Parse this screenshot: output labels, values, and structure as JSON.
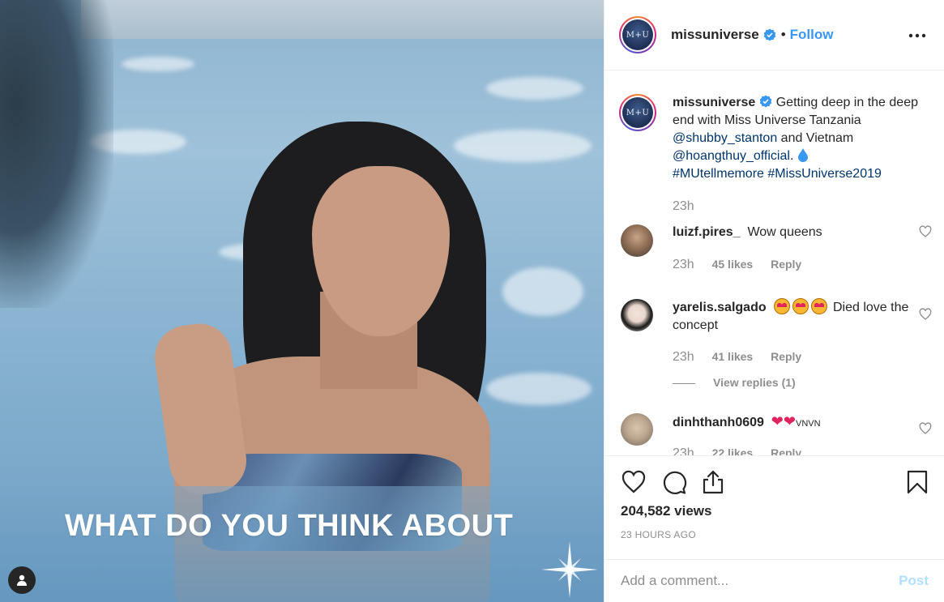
{
  "media": {
    "overlay_caption": "WHAT DO YOU THINK ABOUT",
    "user_tag_icon": "person-icon"
  },
  "header": {
    "avatar_text": "M+U",
    "username": "missuniverse",
    "dot": "•",
    "follow_label": "Follow",
    "more_label": "..."
  },
  "caption": {
    "username": "missuniverse",
    "text_1": "Getting deep in the deep end with Miss Universe Tanzania ",
    "mention_1": "@shubby_stanton",
    "text_2": " and Vietnam ",
    "mention_2": "@hoangthuy_official",
    "text_3": ". ",
    "hashtag_1": "#MUtellmemore",
    "hashtag_2": "#MissUniverse2019",
    "time": "23h"
  },
  "comments": [
    {
      "username": "luizf.pires_",
      "text": "Wow queens",
      "time": "23h",
      "likes": "45 likes",
      "reply": "Reply"
    },
    {
      "username": "yarelis.salgado",
      "text": "Died love the concept",
      "time": "23h",
      "likes": "41 likes",
      "reply": "Reply",
      "view_replies": "View replies (1)"
    },
    {
      "username": "dinhthanh0609",
      "text": "VNVN",
      "time": "23h",
      "likes": "22 likes",
      "reply": "Reply"
    }
  ],
  "actions": {
    "views": "204,582 views",
    "ago": "23 HOURS AGO"
  },
  "add_comment": {
    "placeholder": "Add a comment...",
    "post_label": "Post"
  },
  "colors": {
    "accent": "#3897f0",
    "link": "#003569",
    "muted": "#8e8e8e",
    "post_disabled": "#b2dffc"
  }
}
